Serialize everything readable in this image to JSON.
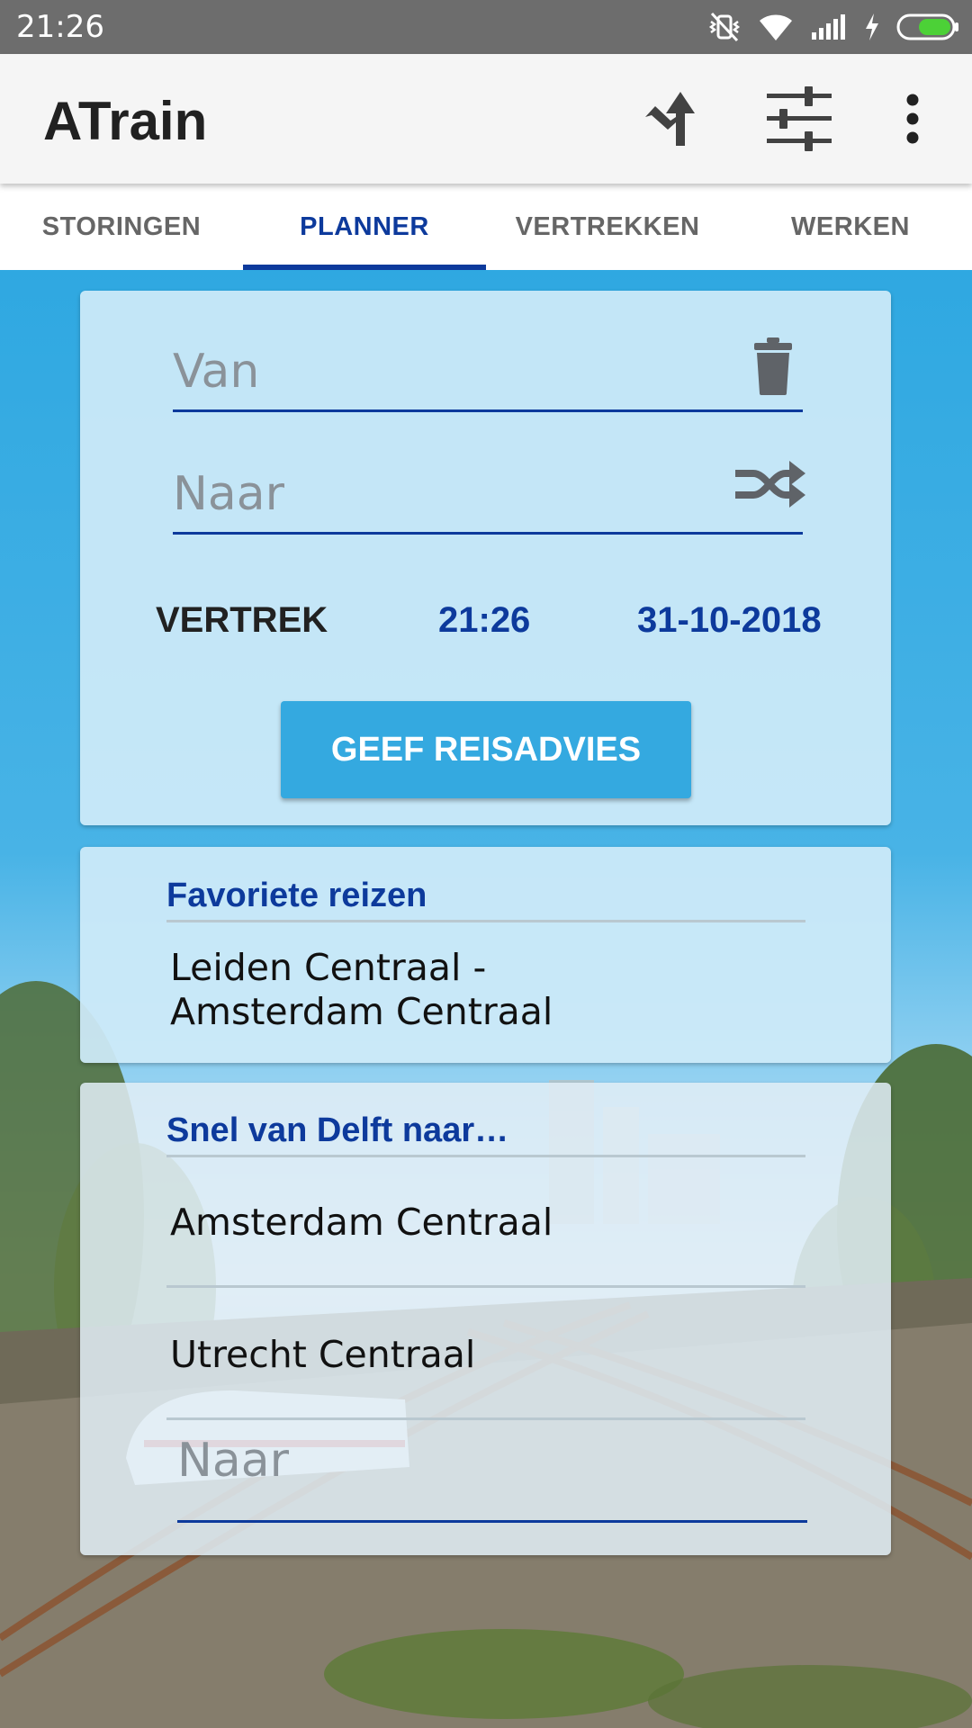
{
  "status_bar": {
    "time": "21:26"
  },
  "app_bar": {
    "title": "ATrain",
    "actions": [
      "navigation-icon",
      "tune-icon",
      "more-vert-icon"
    ]
  },
  "tabs": [
    {
      "label": "STORINGEN",
      "active": false
    },
    {
      "label": "PLANNER",
      "active": true
    },
    {
      "label": "VERTREKKEN",
      "active": false
    },
    {
      "label": "WERKEN",
      "active": false
    }
  ],
  "planner": {
    "from_placeholder": "Van",
    "to_placeholder": "Naar",
    "mode_label": "VERTREK",
    "time": "21:26",
    "date": "31-10-2018",
    "submit_label": "GEEF REISADVIES"
  },
  "favorites": {
    "title": "Favoriete reizen",
    "items": [
      "Leiden Centraal - Amsterdam Centraal"
    ]
  },
  "quick": {
    "title": "Snel van Delft naar…",
    "items": [
      "Amsterdam Centraal",
      "Utrecht Centraal"
    ],
    "input_placeholder": "Naar"
  },
  "colors": {
    "accent": "#0d3a9c",
    "primary": "#34a9e0",
    "status_bar": "#6d6d6d"
  }
}
